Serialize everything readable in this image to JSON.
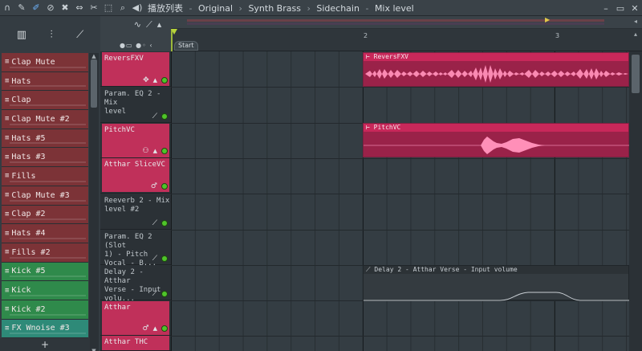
{
  "titlebar": {
    "playlist_label": "播放列表",
    "breadcrumb": [
      "Original",
      "Synth Brass",
      "Sidechain",
      "Mix level"
    ],
    "window_controls": [
      "–",
      "▭",
      "✕"
    ]
  },
  "left_panel": {
    "patterns": [
      {
        "label": "Clap Mute",
        "color": "red"
      },
      {
        "label": "Hats",
        "color": "red"
      },
      {
        "label": "Clap",
        "color": "red"
      },
      {
        "label": "Clap Mute #2",
        "color": "red"
      },
      {
        "label": "Hats #5",
        "color": "red"
      },
      {
        "label": "Hats #3",
        "color": "red"
      },
      {
        "label": "Fills",
        "color": "red"
      },
      {
        "label": "Clap Mute #3",
        "color": "red"
      },
      {
        "label": "Clap #2",
        "color": "red"
      },
      {
        "label": "Hats #4",
        "color": "red"
      },
      {
        "label": "Fills #2",
        "color": "red"
      },
      {
        "label": "Kick #5",
        "color": "green"
      },
      {
        "label": "Kick",
        "color": "green"
      },
      {
        "label": "Kick #2",
        "color": "green"
      },
      {
        "label": "FX Wnoise #3",
        "color": "teal"
      }
    ],
    "add_label": "+"
  },
  "ruler": {
    "start_label": "Start",
    "bar_numbers": [
      "2",
      "3"
    ]
  },
  "tracks": [
    {
      "name": "ReversFXV",
      "style": "pink"
    },
    {
      "name": "Param. EQ 2 - Mix\nlevel",
      "style": "dark"
    },
    {
      "name": "PitchVC",
      "style": "pink"
    },
    {
      "name": "Atthar SliceVC",
      "style": "pink-sub"
    },
    {
      "name": "Reeverb 2 - Mix\nlevel #2",
      "style": "dark"
    },
    {
      "name": "Param. EQ 2 (Slot\n1) - Pitch Vocal - B...",
      "style": "dark"
    },
    {
      "name": "Delay 2 - Atthar\nVerse - Input volu...",
      "style": "dark"
    },
    {
      "name": "Atthar",
      "style": "pink"
    },
    {
      "name": "Atthar THC",
      "style": "pink-sub"
    }
  ],
  "clips": [
    {
      "title": "ReversFXV",
      "type": "audio"
    },
    {
      "title": "PitchVC",
      "type": "audio"
    },
    {
      "title": "Delay 2 - Atthar Verse - Input volume",
      "type": "automation"
    }
  ],
  "colors": {
    "pattern_red": "#7c3337",
    "pattern_green": "#2f8a4b",
    "track_pink": "#c0305a",
    "clip_audio": "#9a2249",
    "wave": "#ff8fb8",
    "led_green": "#4fc42a"
  }
}
